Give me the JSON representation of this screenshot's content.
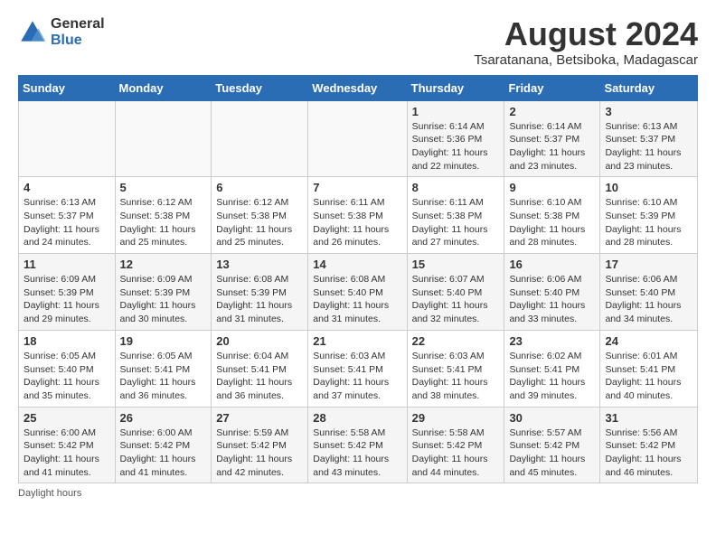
{
  "logo": {
    "general": "General",
    "blue": "Blue"
  },
  "title": "August 2024",
  "subtitle": "Tsaratanana, Betsiboka, Madagascar",
  "header": {
    "days": [
      "Sunday",
      "Monday",
      "Tuesday",
      "Wednesday",
      "Thursday",
      "Friday",
      "Saturday"
    ]
  },
  "weeks": [
    [
      {
        "day": "",
        "info": ""
      },
      {
        "day": "",
        "info": ""
      },
      {
        "day": "",
        "info": ""
      },
      {
        "day": "",
        "info": ""
      },
      {
        "day": "1",
        "info": "Sunrise: 6:14 AM\nSunset: 5:36 PM\nDaylight: 11 hours and 22 minutes."
      },
      {
        "day": "2",
        "info": "Sunrise: 6:14 AM\nSunset: 5:37 PM\nDaylight: 11 hours and 23 minutes."
      },
      {
        "day": "3",
        "info": "Sunrise: 6:13 AM\nSunset: 5:37 PM\nDaylight: 11 hours and 23 minutes."
      }
    ],
    [
      {
        "day": "4",
        "info": "Sunrise: 6:13 AM\nSunset: 5:37 PM\nDaylight: 11 hours and 24 minutes."
      },
      {
        "day": "5",
        "info": "Sunrise: 6:12 AM\nSunset: 5:38 PM\nDaylight: 11 hours and 25 minutes."
      },
      {
        "day": "6",
        "info": "Sunrise: 6:12 AM\nSunset: 5:38 PM\nDaylight: 11 hours and 25 minutes."
      },
      {
        "day": "7",
        "info": "Sunrise: 6:11 AM\nSunset: 5:38 PM\nDaylight: 11 hours and 26 minutes."
      },
      {
        "day": "8",
        "info": "Sunrise: 6:11 AM\nSunset: 5:38 PM\nDaylight: 11 hours and 27 minutes."
      },
      {
        "day": "9",
        "info": "Sunrise: 6:10 AM\nSunset: 5:38 PM\nDaylight: 11 hours and 28 minutes."
      },
      {
        "day": "10",
        "info": "Sunrise: 6:10 AM\nSunset: 5:39 PM\nDaylight: 11 hours and 28 minutes."
      }
    ],
    [
      {
        "day": "11",
        "info": "Sunrise: 6:09 AM\nSunset: 5:39 PM\nDaylight: 11 hours and 29 minutes."
      },
      {
        "day": "12",
        "info": "Sunrise: 6:09 AM\nSunset: 5:39 PM\nDaylight: 11 hours and 30 minutes."
      },
      {
        "day": "13",
        "info": "Sunrise: 6:08 AM\nSunset: 5:39 PM\nDaylight: 11 hours and 31 minutes."
      },
      {
        "day": "14",
        "info": "Sunrise: 6:08 AM\nSunset: 5:40 PM\nDaylight: 11 hours and 31 minutes."
      },
      {
        "day": "15",
        "info": "Sunrise: 6:07 AM\nSunset: 5:40 PM\nDaylight: 11 hours and 32 minutes."
      },
      {
        "day": "16",
        "info": "Sunrise: 6:06 AM\nSunset: 5:40 PM\nDaylight: 11 hours and 33 minutes."
      },
      {
        "day": "17",
        "info": "Sunrise: 6:06 AM\nSunset: 5:40 PM\nDaylight: 11 hours and 34 minutes."
      }
    ],
    [
      {
        "day": "18",
        "info": "Sunrise: 6:05 AM\nSunset: 5:40 PM\nDaylight: 11 hours and 35 minutes."
      },
      {
        "day": "19",
        "info": "Sunrise: 6:05 AM\nSunset: 5:41 PM\nDaylight: 11 hours and 36 minutes."
      },
      {
        "day": "20",
        "info": "Sunrise: 6:04 AM\nSunset: 5:41 PM\nDaylight: 11 hours and 36 minutes."
      },
      {
        "day": "21",
        "info": "Sunrise: 6:03 AM\nSunset: 5:41 PM\nDaylight: 11 hours and 37 minutes."
      },
      {
        "day": "22",
        "info": "Sunrise: 6:03 AM\nSunset: 5:41 PM\nDaylight: 11 hours and 38 minutes."
      },
      {
        "day": "23",
        "info": "Sunrise: 6:02 AM\nSunset: 5:41 PM\nDaylight: 11 hours and 39 minutes."
      },
      {
        "day": "24",
        "info": "Sunrise: 6:01 AM\nSunset: 5:41 PM\nDaylight: 11 hours and 40 minutes."
      }
    ],
    [
      {
        "day": "25",
        "info": "Sunrise: 6:00 AM\nSunset: 5:42 PM\nDaylight: 11 hours and 41 minutes."
      },
      {
        "day": "26",
        "info": "Sunrise: 6:00 AM\nSunset: 5:42 PM\nDaylight: 11 hours and 41 minutes."
      },
      {
        "day": "27",
        "info": "Sunrise: 5:59 AM\nSunset: 5:42 PM\nDaylight: 11 hours and 42 minutes."
      },
      {
        "day": "28",
        "info": "Sunrise: 5:58 AM\nSunset: 5:42 PM\nDaylight: 11 hours and 43 minutes."
      },
      {
        "day": "29",
        "info": "Sunrise: 5:58 AM\nSunset: 5:42 PM\nDaylight: 11 hours and 44 minutes."
      },
      {
        "day": "30",
        "info": "Sunrise: 5:57 AM\nSunset: 5:42 PM\nDaylight: 11 hours and 45 minutes."
      },
      {
        "day": "31",
        "info": "Sunrise: 5:56 AM\nSunset: 5:42 PM\nDaylight: 11 hours and 46 minutes."
      }
    ]
  ],
  "footer": "Daylight hours"
}
